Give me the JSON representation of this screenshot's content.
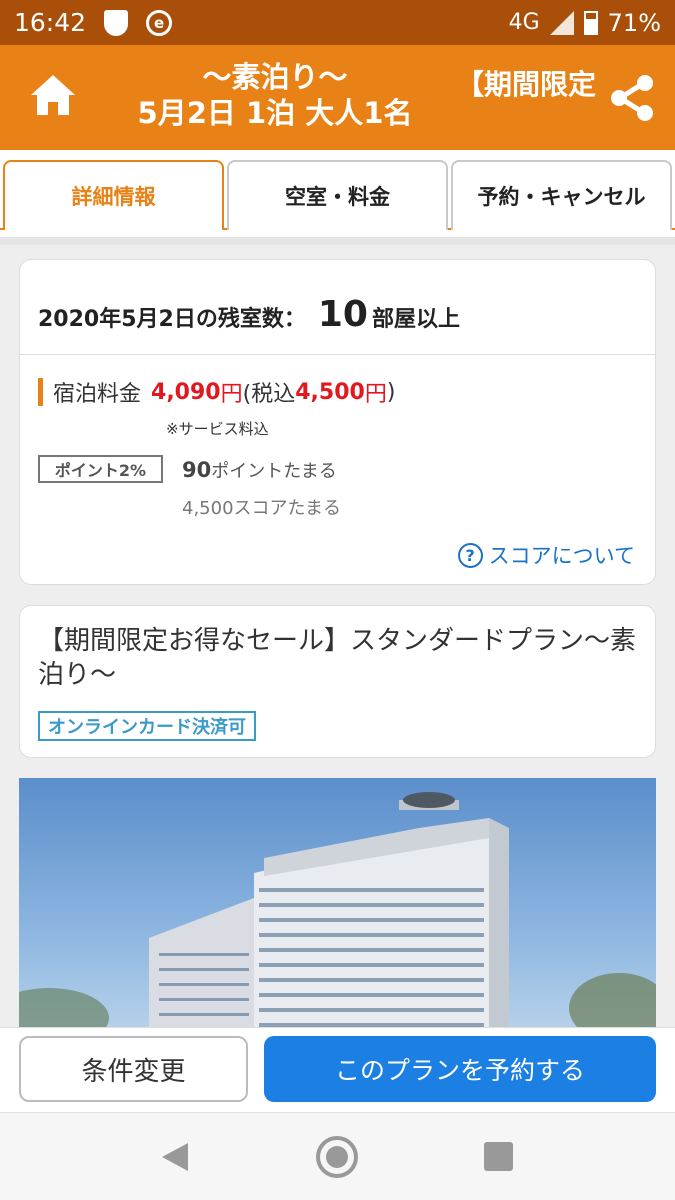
{
  "status_bar": {
    "time": "16:42",
    "network": "4G",
    "battery": "71%",
    "icons": [
      "shield-icon",
      "e-app-icon",
      "signal-icon",
      "battery-icon"
    ]
  },
  "header": {
    "title_line1": "〜素泊り〜",
    "title_line2": "5月2日 1泊 大人1名",
    "marquee": "【期間限定",
    "icons": [
      "home-icon",
      "share-icon"
    ],
    "color": "#e98216"
  },
  "tabs": [
    {
      "label": "詳細情報",
      "active": true
    },
    {
      "label": "空室・料金",
      "active": false
    },
    {
      "label": "予約・キャンセル",
      "active": false
    }
  ],
  "availability": {
    "date_label": "2020年5月2日の残室数：",
    "count": "10",
    "suffix": "部屋以上"
  },
  "price": {
    "label": "宿泊料金",
    "amount": "4,090",
    "unit": "円",
    "tax_prefix": "(税込",
    "tax_amount": "4,500",
    "tax_suffix": ")",
    "service_note": "※サービス料込",
    "accent": "#e0181f"
  },
  "points": {
    "badge": "ポイント2%",
    "amount": "90",
    "amount_suffix": "ポイントたまる",
    "score": "4,500スコアたまる",
    "score_link": "スコアについて"
  },
  "plan": {
    "title": "【期間限定お得なセール】スタンダードプラン〜素泊り〜",
    "payment_badge": "オンラインカード決済可"
  },
  "actions": {
    "change": "条件変更",
    "reserve": "このプランを予約する",
    "reserve_color": "#1c7fe3"
  },
  "nav": {
    "icons": [
      "back-icon",
      "home-circle-icon",
      "recents-icon"
    ]
  }
}
